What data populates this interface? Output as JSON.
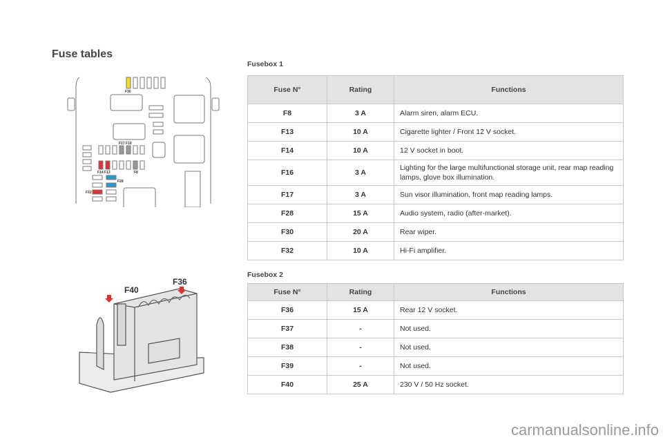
{
  "page": {
    "title": "Fuse tables",
    "watermark": "carmanualsonline.info"
  },
  "fusebox1": {
    "label": "Fusebox 1",
    "headers": [
      "Fuse N°",
      "Rating",
      "Functions"
    ],
    "rows": [
      {
        "fuse": "F8",
        "rating": "3 A",
        "function": "Alarm siren, alarm ECU."
      },
      {
        "fuse": "F13",
        "rating": "10 A",
        "function": "Cigarette lighter / Front 12 V socket."
      },
      {
        "fuse": "F14",
        "rating": "10 A",
        "function": "12 V socket in boot."
      },
      {
        "fuse": "F16",
        "rating": "3 A",
        "function": "Lighting for the large multifunctional storage unit, rear map reading lamps, glove box illumination."
      },
      {
        "fuse": "F17",
        "rating": "3 A",
        "function": "Sun visor illumination, front map reading lamps."
      },
      {
        "fuse": "F28",
        "rating": "15 A",
        "function": "Audio system, radio (after-market)."
      },
      {
        "fuse": "F30",
        "rating": "20 A",
        "function": "Rear wiper."
      },
      {
        "fuse": "F32",
        "rating": "10 A",
        "function": "Hi-Fi amplifier."
      }
    ]
  },
  "fusebox2": {
    "label": "Fusebox 2",
    "headers": [
      "Fuse N°",
      "Rating",
      "Functions"
    ],
    "rows": [
      {
        "fuse": "F36",
        "rating": "15 A",
        "function": "Rear 12 V socket."
      },
      {
        "fuse": "F37",
        "rating": "-",
        "function": "Not used."
      },
      {
        "fuse": "F38",
        "rating": "-",
        "function": "Not used."
      },
      {
        "fuse": "F39",
        "rating": "-",
        "function": "Not used."
      },
      {
        "fuse": "F40",
        "rating": "25 A",
        "function": "230 V / 50 Hz socket."
      }
    ]
  },
  "diagram1": {
    "labels": {
      "f30": "F30",
      "f17f16": "F17 F16",
      "f14f13": "F14 F13",
      "f8": "F8",
      "f28": "F28",
      "f32": "F32"
    },
    "colors": {
      "yellow": "#f2e224",
      "red": "#e03030",
      "blue": "#2b9ac8",
      "grey": "#9a9a9a"
    }
  },
  "diagram2": {
    "labels": {
      "f40": "F40",
      "f36": "F36"
    },
    "colors": {
      "arrow": "#e03030"
    }
  }
}
